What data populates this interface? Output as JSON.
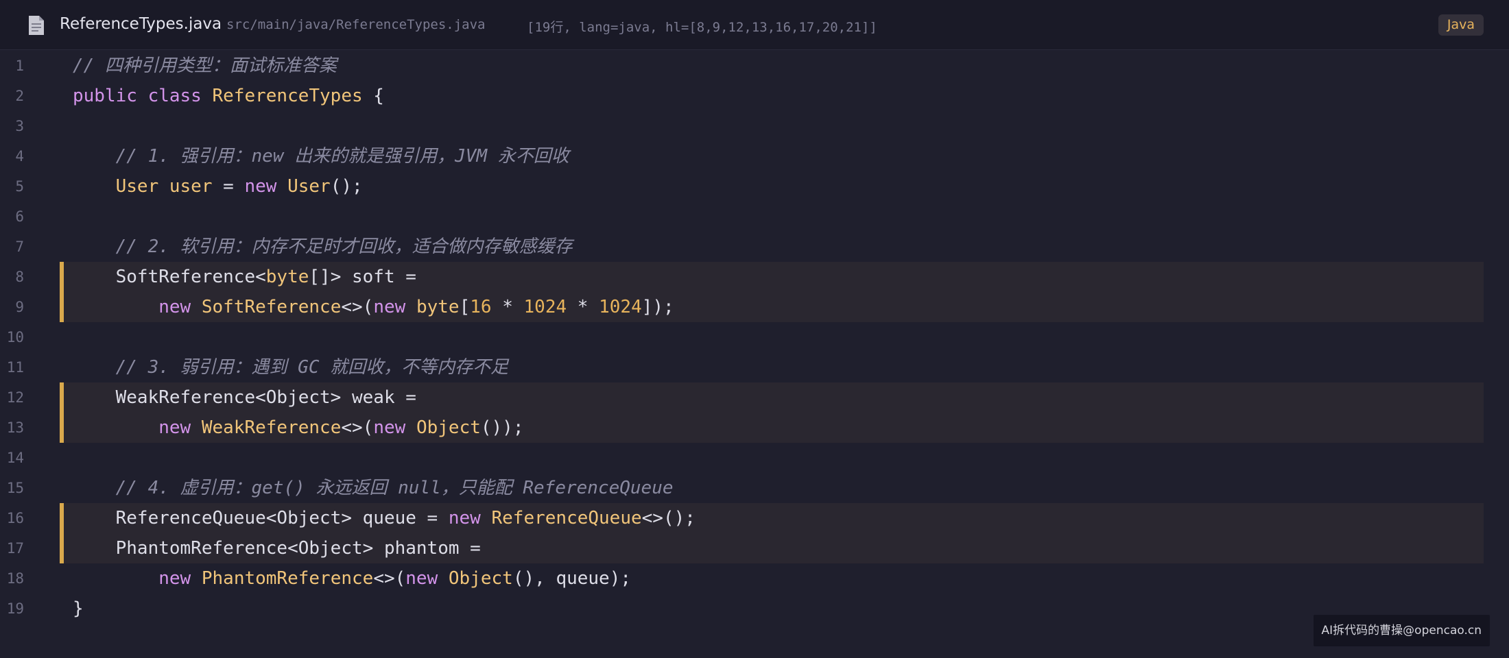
{
  "header": {
    "file_icon": "file-icon",
    "filename": "ReferenceTypes.java",
    "path": "src/main/java/ReferenceTypes.java",
    "meta": "[19行, lang=java, hl=[8,9,12,13,16,17,20,21]]",
    "language": "Java"
  },
  "colors": {
    "background": "#1f1f2d",
    "highlight_background": "#2a2730",
    "highlight_bar": "#d9a94c",
    "keyword": "#d394ea",
    "type": "#f1c57a",
    "number": "#e8b45c",
    "comment": "#8a8aa0"
  },
  "code": {
    "highlighted_lines": [
      8,
      9,
      12,
      13,
      16,
      17
    ],
    "lines": [
      {
        "n": "1",
        "tokens": [
          {
            "t": "// 四种引用类型：面试标准答案",
            "k": "comment"
          }
        ]
      },
      {
        "n": "2",
        "tokens": [
          {
            "t": "public class ",
            "k": "keyword"
          },
          {
            "t": "ReferenceTypes",
            "k": "type"
          },
          {
            "t": " {",
            "k": "plain"
          }
        ]
      },
      {
        "n": "3",
        "tokens": []
      },
      {
        "n": "4",
        "tokens": [
          {
            "t": "    // 1. 强引用：new 出来的就是强引用，JVM 永不回收",
            "k": "comment"
          }
        ]
      },
      {
        "n": "5",
        "tokens": [
          {
            "t": "    User user",
            "k": "type"
          },
          {
            "t": " = ",
            "k": "plain"
          },
          {
            "t": "new ",
            "k": "keyword"
          },
          {
            "t": "User",
            "k": "type"
          },
          {
            "t": "();",
            "k": "plain"
          }
        ]
      },
      {
        "n": "6",
        "tokens": []
      },
      {
        "n": "7",
        "tokens": [
          {
            "t": "    // 2. 软引用：内存不足时才回收，适合做内存敏感缓存",
            "k": "comment"
          }
        ]
      },
      {
        "n": "8",
        "tokens": [
          {
            "t": "    SoftReference<",
            "k": "plain"
          },
          {
            "t": "byte",
            "k": "type"
          },
          {
            "t": "[]> soft =",
            "k": "plain"
          }
        ]
      },
      {
        "n": "9",
        "tokens": [
          {
            "t": "        ",
            "k": "plain"
          },
          {
            "t": "new ",
            "k": "keyword"
          },
          {
            "t": "SoftReference",
            "k": "type"
          },
          {
            "t": "<>(",
            "k": "plain"
          },
          {
            "t": "new ",
            "k": "keyword"
          },
          {
            "t": "byte",
            "k": "type"
          },
          {
            "t": "[",
            "k": "plain"
          },
          {
            "t": "16",
            "k": "number"
          },
          {
            "t": " * ",
            "k": "plain"
          },
          {
            "t": "1024",
            "k": "number"
          },
          {
            "t": " * ",
            "k": "plain"
          },
          {
            "t": "1024",
            "k": "number"
          },
          {
            "t": "]);",
            "k": "plain"
          }
        ]
      },
      {
        "n": "10",
        "tokens": []
      },
      {
        "n": "11",
        "tokens": [
          {
            "t": "    // 3. 弱引用：遇到 GC 就回收，不等内存不足",
            "k": "comment"
          }
        ]
      },
      {
        "n": "12",
        "tokens": [
          {
            "t": "    WeakReference<Object> weak =",
            "k": "plain"
          }
        ]
      },
      {
        "n": "13",
        "tokens": [
          {
            "t": "        ",
            "k": "plain"
          },
          {
            "t": "new ",
            "k": "keyword"
          },
          {
            "t": "WeakReference",
            "k": "type"
          },
          {
            "t": "<>(",
            "k": "plain"
          },
          {
            "t": "new ",
            "k": "keyword"
          },
          {
            "t": "Object",
            "k": "type"
          },
          {
            "t": "());",
            "k": "plain"
          }
        ]
      },
      {
        "n": "14",
        "tokens": []
      },
      {
        "n": "15",
        "tokens": [
          {
            "t": "    // 4. 虚引用：get() 永远返回 null，只能配 ReferenceQueue",
            "k": "comment"
          }
        ]
      },
      {
        "n": "16",
        "tokens": [
          {
            "t": "    ReferenceQueue<Object> queue = ",
            "k": "plain"
          },
          {
            "t": "new ",
            "k": "keyword"
          },
          {
            "t": "ReferenceQueue",
            "k": "type"
          },
          {
            "t": "<>();",
            "k": "plain"
          }
        ]
      },
      {
        "n": "17",
        "tokens": [
          {
            "t": "    PhantomReference<Object> phantom =",
            "k": "plain"
          }
        ]
      },
      {
        "n": "18",
        "tokens": [
          {
            "t": "        ",
            "k": "plain"
          },
          {
            "t": "new ",
            "k": "keyword"
          },
          {
            "t": "PhantomReference",
            "k": "type"
          },
          {
            "t": "<>(",
            "k": "plain"
          },
          {
            "t": "new ",
            "k": "keyword"
          },
          {
            "t": "Object",
            "k": "type"
          },
          {
            "t": "(), queue);",
            "k": "plain"
          }
        ]
      },
      {
        "n": "19",
        "tokens": [
          {
            "t": "}",
            "k": "plain"
          }
        ]
      }
    ]
  },
  "watermark": "AI拆代码的曹操@opencao.cn"
}
